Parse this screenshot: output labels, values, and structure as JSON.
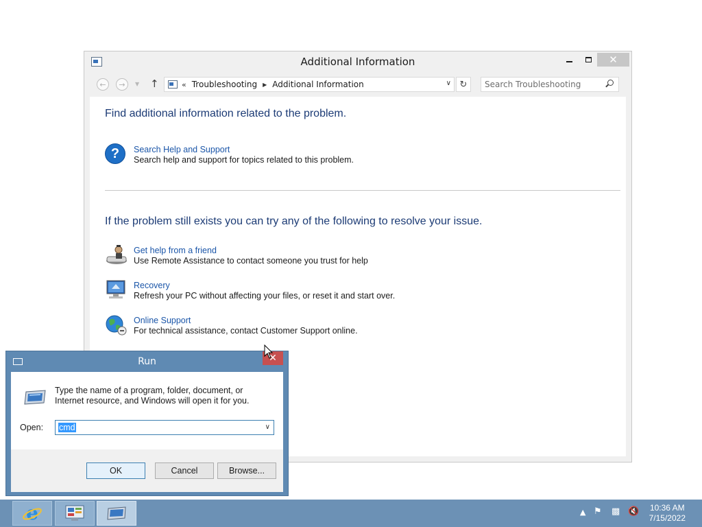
{
  "window": {
    "title": "Additional Information",
    "minimize": "–",
    "close": "✕",
    "address": {
      "chevron": "«",
      "crumbs": [
        "Troubleshooting",
        "Additional Information"
      ]
    },
    "search_placeholder": "Search Troubleshooting",
    "heading1": "Find additional information related to the problem.",
    "help_item": {
      "icon": "help-icon",
      "link": "Search Help and Support",
      "desc": "Search help and support for topics related to this problem."
    },
    "heading2": "If the problem still exists you can try any of the following to resolve your issue.",
    "items": [
      {
        "icon": "remote-assistance-icon",
        "link": "Get help from a friend",
        "desc": "Use Remote Assistance to contact someone you trust for help"
      },
      {
        "icon": "recovery-icon",
        "link": "Recovery",
        "desc": "Refresh your PC without affecting your files, or reset it and start over."
      },
      {
        "icon": "online-support-icon",
        "link": "Online Support",
        "desc": "For technical assistance, contact Customer Support online."
      }
    ]
  },
  "run_dialog": {
    "title": "Run",
    "close": "✕",
    "message": "Type the name of a program, folder, document, or Internet resource, and Windows will open it for you.",
    "open_label": "Open:",
    "open_value": "cmd",
    "ok": "OK",
    "cancel": "Cancel",
    "browse": "Browse..."
  },
  "taskbar": {
    "apps": [
      "internet-explorer-icon",
      "control-panel-icon",
      "run-icon"
    ],
    "time": "10:36 AM",
    "date": "7/15/2022",
    "tray_icons": [
      "show-hidden-icons",
      "flag-icon",
      "network-icon",
      "volume-muted-icon"
    ]
  },
  "colors": {
    "heading": "#1c3b75",
    "link": "#1a55a8",
    "taskbar": "#6c91b5",
    "run_frame": "#5f8ab3",
    "selection": "#3399ff"
  }
}
